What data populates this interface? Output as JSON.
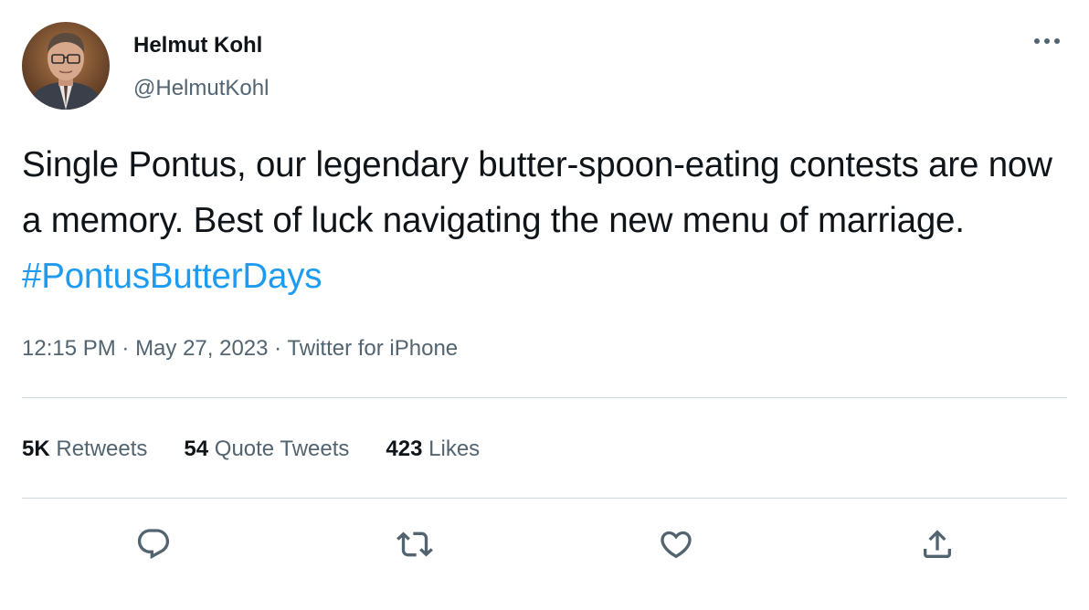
{
  "author": {
    "display_name": "Helmut Kohl",
    "handle": "@HelmutKohl",
    "avatar_icon": "avatar-photo"
  },
  "tweet": {
    "text": "Single Pontus, our legendary butter-spoon-eating contests are now a memory. Best of luck navigating the new menu of marriage. ",
    "hashtag": "#PontusButterDays",
    "time": "12:15 PM",
    "separator": " · ",
    "date": "May 27, 2023",
    "source": "Twitter for iPhone"
  },
  "stats": {
    "retweets_count": "5K",
    "retweets_label": " Retweets",
    "quotes_count": "54",
    "quotes_label": " Quote Tweets",
    "likes_count": "423",
    "likes_label": " Likes"
  },
  "icons": {
    "more": "more-icon",
    "reply": "reply-icon",
    "retweet": "retweet-icon",
    "like": "heart-icon",
    "share": "share-icon"
  },
  "colors": {
    "text": "#0f1419",
    "secondary": "#536471",
    "link": "#1d9bf0",
    "divider": "#cfd9de"
  }
}
